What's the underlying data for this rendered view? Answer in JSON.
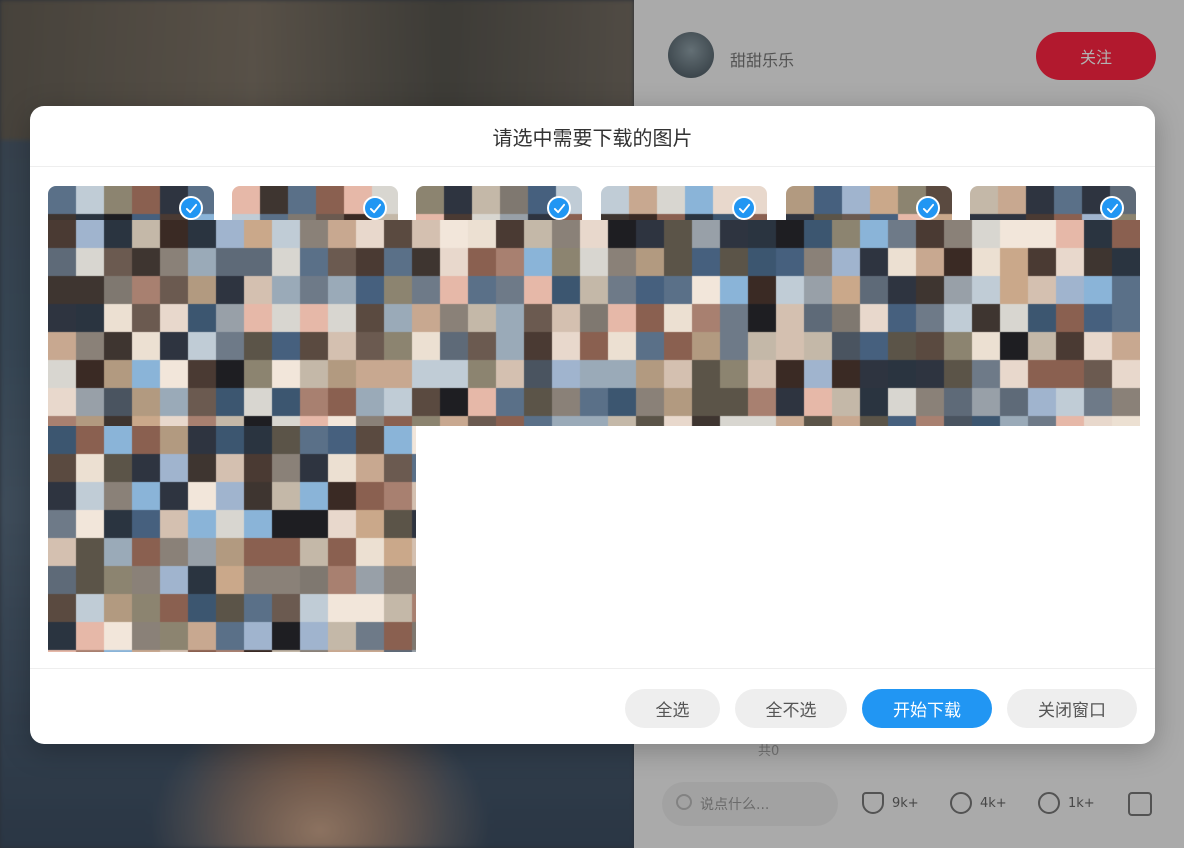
{
  "background": {
    "author_name": "甜甜乐乐",
    "follow_label": "关注",
    "comment_placeholder": "说点什么...",
    "comment_count_label": "共0",
    "stats": [
      "9k+",
      "4k+",
      "1k+"
    ]
  },
  "modal": {
    "title": "请选中需要下载的图片",
    "images": [
      {
        "selected": true
      },
      {
        "selected": true
      },
      {
        "selected": true
      },
      {
        "selected": true
      },
      {
        "selected": true
      },
      {
        "selected": true
      },
      {
        "selected": true
      }
    ],
    "buttons": {
      "select_all": "全选",
      "select_none": "全不选",
      "start_download": "开始下载",
      "close_window": "关闭窗口"
    }
  },
  "colors": {
    "accent": "#2196f3",
    "follow": "#ff2442",
    "button_grey": "#eeeeee"
  }
}
